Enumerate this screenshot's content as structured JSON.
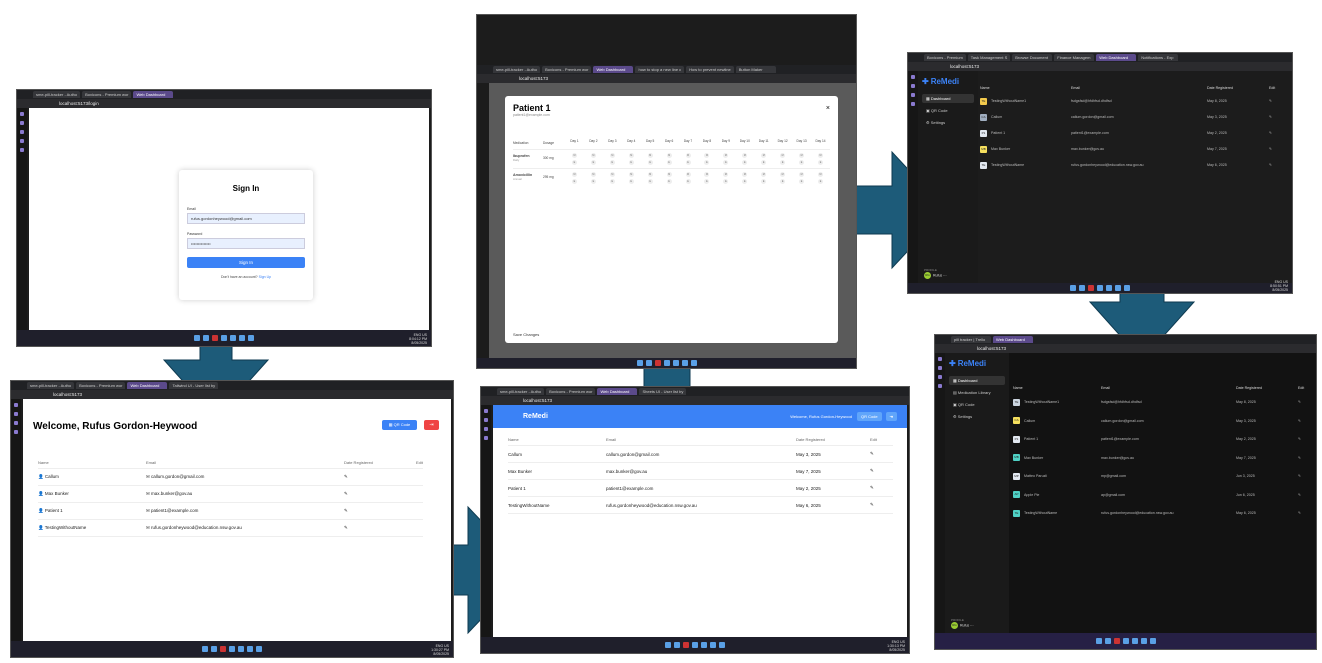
{
  "panel1": {
    "tabs": [
      "sme-pill-tracker - Autho",
      "Boxicons - Premium wor",
      "Web Dashboard"
    ],
    "url": "localhost:5173/login",
    "title": "Sign In",
    "email_label": "Email",
    "email_value": "rufus.gordonheywood@gmail.com",
    "password_label": "Password",
    "password_value": "••••••••••••••",
    "signin_button": "Sign In",
    "signup_text": "Don't have an account?",
    "signup_link": "Sign Up",
    "tray": {
      "lang": "ENG US",
      "time": "8:04:12 PM",
      "date": "8/05/2025"
    }
  },
  "panel2": {
    "tabs": [
      "sme-pill-tracker - Autho",
      "Boxicons - Premium wor",
      "Web Dashboard",
      "Tailwind UI - User list by"
    ],
    "url": "localhost:5173",
    "welcome": "Welcome, Rufus Gordon-Heywood",
    "qr_button": "QR Code",
    "headers": [
      "Name",
      "Email",
      "Date Registered",
      "Edit"
    ],
    "rows": [
      {
        "name": "Callum",
        "email": "callum.gordon@gmail.com"
      },
      {
        "name": "Max Bunker",
        "email": "max.bunker@gov.au"
      },
      {
        "name": "Patient 1",
        "email": "patient1@example.com"
      },
      {
        "name": "TestingWithoutName",
        "email": "rufus.gordonheywood@education.nsw.gov.au"
      }
    ],
    "tray": {
      "lang": "ENG US",
      "time": "1:30:27 PM",
      "date": "8/05/2025"
    }
  },
  "panel3": {
    "tabs": [
      "sme-pill-tracker - Autho",
      "Boxicons - Premium wor",
      "Web Dashboard",
      "Sheets UI - User list by"
    ],
    "url": "localhost:5173",
    "brand": "ReMedi",
    "welcome": "Welcome, Rufus Gordon-Heywood",
    "qr_button": "QR Code",
    "headers": [
      "Name",
      "Email",
      "Date Registered",
      "Edit"
    ],
    "rows": [
      {
        "name": "Callum",
        "email": "callum.gordon@gmail.com",
        "date": "May 3, 2025"
      },
      {
        "name": "Max Bunker",
        "email": "max.bunker@gov.au",
        "date": "May 7, 2025"
      },
      {
        "name": "Patient 1",
        "email": "patient1@example.com",
        "date": "May 2, 2025"
      },
      {
        "name": "TestingWithoutName",
        "email": "rufus.gordonheywood@education.nsw.gov.au",
        "date": "May 6, 2025"
      }
    ],
    "tray": {
      "lang": "ENG US",
      "time": "1:30:13 PM",
      "date": "8/05/2025"
    }
  },
  "panel4": {
    "tabs": [
      "sme-pill-tracker - Autho",
      "Boxicons - Premium wor",
      "Web Dashboard",
      "how to stop a new line c",
      "How to prevent newline",
      "Button Maker"
    ],
    "url": "localhost:5173",
    "patient": "Patient 1",
    "patient_email": "patient1@example.com",
    "col_med": "Medication",
    "col_dose": "Dosage",
    "days": [
      "Day 1",
      "Day 2",
      "Day 3",
      "Day 4",
      "Day 5",
      "Day 6",
      "Day 7",
      "Day 8",
      "Day 9",
      "Day 10",
      "Day 11",
      "Day 12",
      "Day 13",
      "Day 14"
    ],
    "meds": [
      {
        "name": "Ibuprofen",
        "sub": "Daily",
        "dose": "300 mg"
      },
      {
        "name": "Amoxicillin",
        "sub": "Annual",
        "dose": "295 mg"
      }
    ],
    "pill_m": "M",
    "pill_e": "E",
    "save": "Save Changes"
  },
  "panel5": {
    "tabs": [
      "Boxicons - Premium",
      "Task Management S",
      "Browse Document",
      "Finance Managem",
      "Web Dashboard",
      "Notifications - Exp"
    ],
    "url": "localhost:5173",
    "brand": "ReMedi",
    "nav": [
      "Dashboard",
      "QR Code",
      "Settings"
    ],
    "headers": [
      "Name",
      "Email",
      "Date Registered",
      "Edit"
    ],
    "rows": [
      {
        "ini": "TE",
        "name": "TestingWithoutName1",
        "email": "fsdgsfsd@hfdhfsd.dhdfsd",
        "date": "May 8, 2025",
        "color": "#f2c94c"
      },
      {
        "ini": "CA",
        "name": "Callum",
        "email": "callum.gordon@gmail.com",
        "date": "May 3, 2025",
        "color": "#a0aec0"
      },
      {
        "ini": "P1",
        "name": "Patient 1",
        "email": "patient1@example.com",
        "date": "May 2, 2025",
        "color": "#e2e8f0"
      },
      {
        "ini": "MB",
        "name": "Max Bunker",
        "email": "max.bunker@gov.au",
        "date": "May 7, 2025",
        "color": "#f6e05e"
      },
      {
        "ini": "TE",
        "name": "TestingWithoutName",
        "email": "rufus.gordonheywood@education.nsw.gov.au",
        "date": "May 6, 2025",
        "color": "#e2e8f0"
      }
    ],
    "profile_label": "PROFILE",
    "profile_name": "Rufus",
    "tray": {
      "lang": "ENG US",
      "time": "8:50:51 PM",
      "date": "8/05/2025"
    }
  },
  "panel6": {
    "tabs": [
      "pill tracker | Trello",
      "Web Dashboard"
    ],
    "url": "localhost:5173",
    "brand": "ReMedi",
    "nav": [
      "Dashboard",
      "Medication Library",
      "QR Code",
      "Settings"
    ],
    "headers": [
      "Name",
      "Email",
      "Date Registered",
      "Edit"
    ],
    "rows": [
      {
        "ini": "TE",
        "name": "TestingWithoutName1",
        "email": "fsdgsfsd@hfdhfsd.dhdfsd",
        "date": "May 8, 2025",
        "color": "#cbd5e0"
      },
      {
        "ini": "CA",
        "name": "Callum",
        "email": "callum.gordon@gmail.com",
        "date": "May 3, 2025",
        "color": "#f6e05e"
      },
      {
        "ini": "P1",
        "name": "Patient 1",
        "email": "patient1@example.com",
        "date": "May 2, 2025",
        "color": "#e2e8f0"
      },
      {
        "ini": "MB",
        "name": "Max Bunker",
        "email": "max.bunker@gov.au",
        "date": "May 7, 2025",
        "color": "#4fd1c5"
      },
      {
        "ini": "MP",
        "name": "Matteo Paruzli",
        "email": "mp@gmail.com",
        "date": "Jun 3, 2025",
        "color": "#e2e8f0"
      },
      {
        "ini": "AP",
        "name": "Apple Pie",
        "email": "ap@gmail.com",
        "date": "Jun 6, 2025",
        "color": "#4fd1c5"
      },
      {
        "ini": "TE",
        "name": "TestingWithoutName",
        "email": "rufus.gordonheywood@education.nsw.gov.au",
        "date": "May 6, 2025",
        "color": "#4fd1c5"
      }
    ],
    "profile_label": "PROFILE",
    "profile_name": "Rufus"
  }
}
